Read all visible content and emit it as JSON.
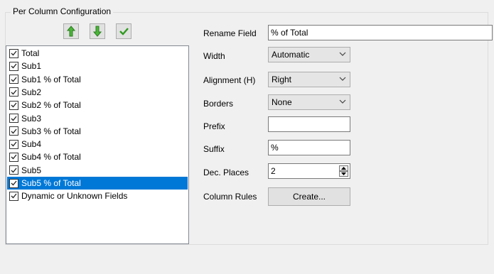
{
  "group": {
    "title": "Per Column Configuration"
  },
  "toolbar": {
    "move_up_icon": "green-arrow-up-icon",
    "move_down_icon": "green-arrow-down-icon",
    "apply_icon": "green-checkmark-icon",
    "accent_color": "#3fae2a"
  },
  "columns": {
    "items": [
      {
        "label": "Total",
        "checked": true
      },
      {
        "label": "Sub1",
        "checked": true
      },
      {
        "label": "Sub1 % of Total",
        "checked": true
      },
      {
        "label": "Sub2",
        "checked": true
      },
      {
        "label": "Sub2 % of Total",
        "checked": true
      },
      {
        "label": "Sub3",
        "checked": true
      },
      {
        "label": "Sub3 % of Total",
        "checked": true
      },
      {
        "label": "Sub4",
        "checked": true
      },
      {
        "label": "Sub4 % of Total",
        "checked": true
      },
      {
        "label": "Sub5",
        "checked": true
      },
      {
        "label": "Sub5 % of Total",
        "checked": true,
        "selected": true
      },
      {
        "label": "Dynamic or Unknown Fields",
        "checked": true
      }
    ],
    "selection_color": "#0078d7"
  },
  "form": {
    "rename_label": "Rename Field",
    "rename_value": "% of Total",
    "width_label": "Width",
    "width_value": "Automatic",
    "alignment_label": "Alignment (H)",
    "alignment_value": "Right",
    "borders_label": "Borders",
    "borders_value": "None",
    "prefix_label": "Prefix",
    "prefix_value": "",
    "suffix_label": "Suffix",
    "suffix_value": "%",
    "decplaces_label": "Dec. Places",
    "decplaces_value": "2",
    "rules_label": "Column Rules",
    "create_button": "Create..."
  }
}
